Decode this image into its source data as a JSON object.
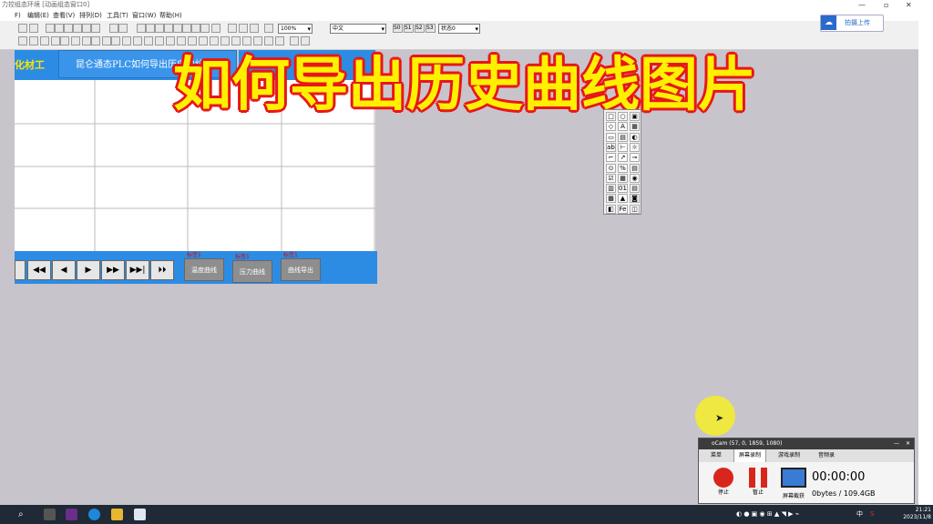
{
  "window": {
    "title": "力控组态环境   [动画组态窗口0]"
  },
  "menu": [
    "F)",
    "编辑(E)",
    "查看(V)",
    "排列(D)",
    "工具(T)",
    "窗口(W)",
    "帮助(H)"
  ],
  "toolbar": {
    "zoom": "100%",
    "language": "中文",
    "buttons_after": [
      "S0",
      "S1",
      "S2",
      "S3"
    ],
    "state": "状态0"
  },
  "upload": {
    "label": "拍摄上传"
  },
  "header": {
    "logo": "化材工",
    "title": "昆仑通态PLC如何导出历史曲线图片"
  },
  "overlay": {
    "text": "如何导出历史曲线图片"
  },
  "nav_buttons": [
    "⏴⏴",
    "◀◀",
    "◀",
    "▶",
    "▶▶",
    "▶▶|",
    "⏵⏵"
  ],
  "curve_buttons": [
    {
      "tag": "标签1",
      "label": "温度曲线"
    },
    {
      "tag": "标签1",
      "label": "压力曲线"
    },
    {
      "tag": "标签1",
      "label": "曲线导出"
    }
  ],
  "palette_cells": [
    "□",
    "○",
    "▣",
    "◇",
    "A",
    "▦",
    "▭",
    "▤",
    "◐",
    "ab",
    "⊢",
    "☼",
    "⌐",
    "↗",
    "⊸",
    "⊙",
    "%",
    "▤",
    "☑",
    "▦",
    "◉",
    "▥",
    "01",
    "▤",
    "▩",
    "▲",
    "◙",
    "◧",
    "Fe",
    "◫"
  ],
  "ocam": {
    "title": "oCam (57, 0, 1859, 1080)",
    "tabs": [
      "菜单",
      "屏幕录制",
      "游戏录制",
      "音频录"
    ],
    "stop1": "停止",
    "stop2": "暂止",
    "screen": "屏幕截获",
    "time": "00:00:00",
    "size": "0bytes / 109.4GB"
  },
  "taskbar": {
    "ime": "中",
    "time": "21:21",
    "date": "2023/11/8"
  }
}
